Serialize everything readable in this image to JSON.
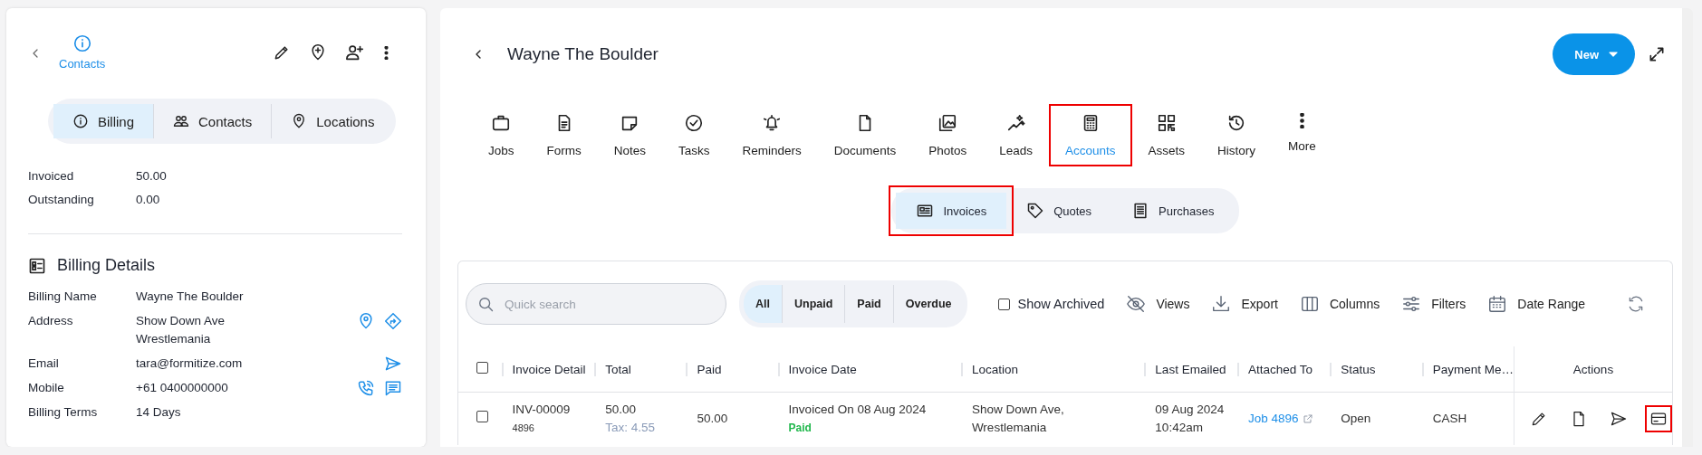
{
  "contact_panel": {
    "header_tab": {
      "label": "Contacts",
      "selected": true
    },
    "tabs": [
      {
        "label": "Billing",
        "selected": true
      },
      {
        "label": "Contacts",
        "selected": false
      },
      {
        "label": "Locations",
        "selected": false
      }
    ],
    "summary": [
      {
        "label": "Invoiced",
        "value": "50.00"
      },
      {
        "label": "Outstanding",
        "value": "0.00"
      }
    ],
    "billing_details": {
      "title": "Billing Details",
      "fields": [
        {
          "kind": "text",
          "label": "Billing Name",
          "value": "Wayne The Boulder"
        },
        {
          "kind": "address",
          "label": "Address",
          "value": "Show Down Ave\nWrestlemania"
        },
        {
          "kind": "email",
          "label": "Email",
          "value": "tara@formitize.com"
        },
        {
          "kind": "phone",
          "label": "Mobile",
          "value": "+61 0400000000"
        },
        {
          "kind": "text",
          "label": "Billing Terms",
          "value": "14 Days"
        }
      ]
    }
  },
  "record": {
    "title": "Wayne The Boulder",
    "new_button": "New",
    "nav": [
      {
        "label": "Jobs",
        "selected": false,
        "highlighted": false
      },
      {
        "label": "Forms",
        "selected": false,
        "highlighted": false
      },
      {
        "label": "Notes",
        "selected": false,
        "highlighted": false
      },
      {
        "label": "Tasks",
        "selected": false,
        "highlighted": false
      },
      {
        "label": "Reminders",
        "selected": false,
        "highlighted": false
      },
      {
        "label": "Documents",
        "selected": false,
        "highlighted": false
      },
      {
        "label": "Photos",
        "selected": false,
        "highlighted": false
      },
      {
        "label": "Leads",
        "selected": false,
        "highlighted": false
      },
      {
        "label": "Accounts",
        "selected": true,
        "highlighted": true
      },
      {
        "label": "Assets",
        "selected": false,
        "highlighted": false
      },
      {
        "label": "History",
        "selected": false,
        "highlighted": false
      },
      {
        "label": "More",
        "selected": false,
        "highlighted": false
      }
    ],
    "subtabs": [
      {
        "label": "Invoices",
        "selected": true,
        "highlighted": true
      },
      {
        "label": "Quotes",
        "selected": false,
        "highlighted": false
      },
      {
        "label": "Purchases",
        "selected": false,
        "highlighted": false
      }
    ],
    "search": {
      "placeholder": "Quick search"
    },
    "filters": [
      {
        "label": "All",
        "selected": true
      },
      {
        "label": "Unpaid",
        "selected": false
      },
      {
        "label": "Paid",
        "selected": false
      },
      {
        "label": "Overdue",
        "selected": false
      }
    ],
    "show_archived": {
      "label": "Show Archived",
      "checked": false
    },
    "tools": [
      "Views",
      "Export",
      "Columns",
      "Filters",
      "Date Range"
    ],
    "table": {
      "all_selected": false,
      "columns": [
        "Invoice Detail",
        "Total",
        "Paid",
        "Invoice Date",
        "Location",
        "Last Emailed",
        "Attached To",
        "Status",
        "Payment Me…"
      ],
      "actions_column": "Actions",
      "rows": [
        {
          "selected": false,
          "invoice_detail": "INV-00009",
          "reference": "4896",
          "total": "50.00",
          "tax": "Tax: 4.55",
          "paid": "50.00",
          "invoice_date": "Invoiced On 08 Aug 2024",
          "payment_status": "Paid",
          "location": "Show Down Ave,\nWrestlemania",
          "last_emailed": "09 Aug 2024\n10:42am",
          "attached_to": "Job 4896",
          "status": "Open",
          "payment_method": "CASH",
          "actions": [
            {
              "highlighted": false
            },
            {
              "highlighted": false
            },
            {
              "highlighted": false
            },
            {
              "highlighted": true
            }
          ]
        }
      ]
    }
  }
}
